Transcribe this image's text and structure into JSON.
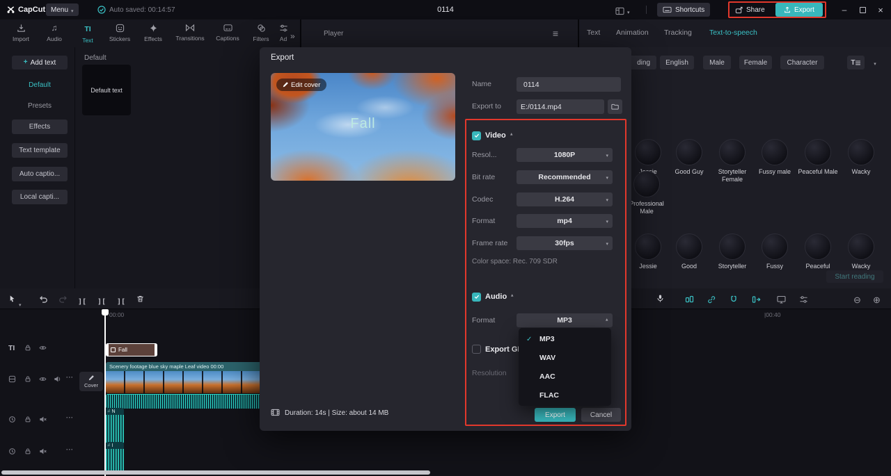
{
  "topbar": {
    "logo": "CapCut",
    "menu_label": "Menu",
    "autosave": "Auto saved: 00:14:57",
    "project_title": "0114",
    "shortcuts_label": "Shortcuts",
    "share_label": "Share",
    "export_label": "Export"
  },
  "media_toolbar": {
    "items": [
      {
        "label": "Import"
      },
      {
        "label": "Audio"
      },
      {
        "label": "Text"
      },
      {
        "label": "Stickers"
      },
      {
        "label": "Effects"
      },
      {
        "label": "Transitions"
      },
      {
        "label": "Captions"
      },
      {
        "label": "Filters"
      },
      {
        "label": "Ad"
      }
    ]
  },
  "text_panel": {
    "add_text": "Add text",
    "items": [
      "Default",
      "Presets",
      "Effects",
      "Text template",
      "Auto captio...",
      "Local capti..."
    ],
    "section_header": "Default",
    "card_label": "Default text"
  },
  "player": {
    "label": "Player"
  },
  "tts_panel": {
    "tabs": [
      "Text",
      "Animation",
      "Tracking",
      "Text-to-speech"
    ],
    "tags": [
      "ding",
      "English",
      "Male",
      "Female",
      "Character"
    ],
    "voices": [
      "Jessie",
      "Good Guy",
      "Storyteller Female",
      "Fussy male",
      "Peaceful Male",
      "Wacky"
    ],
    "voice_wrapped": "Professional Male",
    "voices_bottom": [
      "Jessie",
      "Good",
      "Storyteller",
      "Fussy",
      "Peaceful",
      "Wacky"
    ],
    "start_reading": "Start reading"
  },
  "export_dialog": {
    "title": "Export",
    "edit_cover": "Edit cover",
    "cover_title": "Fall",
    "name_label": "Name",
    "name_value": "0114",
    "export_to_label": "Export to",
    "export_to_value": "E:/0114.mp4",
    "video_section": {
      "label": "Video",
      "fields": [
        {
          "label": "Resol...",
          "value": "1080P"
        },
        {
          "label": "Bit rate",
          "value": "Recommended"
        },
        {
          "label": "Codec",
          "value": "H.264"
        },
        {
          "label": "Format",
          "value": "mp4"
        },
        {
          "label": "Frame rate",
          "value": "30fps"
        }
      ],
      "color_space": "Color space: Rec. 709 SDR"
    },
    "audio_section": {
      "label": "Audio",
      "format_label": "Format",
      "format_value": "MP3",
      "options": [
        "MP3",
        "WAV",
        "AAC",
        "FLAC"
      ],
      "selected": "MP3"
    },
    "gif_label": "Export GIF",
    "resolution_label": "Resolution",
    "footer": "Duration: 14s | Size: about 14 MB",
    "export_button": "Export",
    "cancel_button": "Cancel"
  },
  "timeline": {
    "time_start": "00:00",
    "time_mark": "|00:40",
    "text_clip": "Fall",
    "cover_button": "Cover",
    "video_clip_title": "Scenery footage blue sky maple Leaf video  00:00",
    "audio_clip_a": "N",
    "audio_clip_b": "I"
  }
}
